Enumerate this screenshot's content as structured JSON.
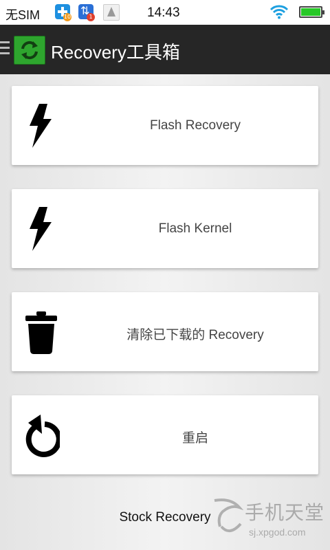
{
  "statusbar": {
    "carrier": "无SIM",
    "time": "14:43",
    "notifications": [
      {
        "name": "plus-app-icon",
        "badge": "10"
      },
      {
        "name": "sync-app-icon",
        "badge": "1"
      },
      {
        "name": "ship-icon"
      }
    ],
    "wifi_icon": "wifi-icon",
    "battery_icon": "battery-full-icon",
    "battery_color": "#28c828"
  },
  "actionbar": {
    "title": "Recovery工具箱",
    "app_icon": "refresh-arrows-icon",
    "background": "#262626"
  },
  "cards": [
    {
      "label": "Flash Recovery",
      "icon": "lightning-icon"
    },
    {
      "label": "Flash Kernel",
      "icon": "lightning-icon"
    },
    {
      "label": "清除已下载的 Recovery",
      "icon": "trash-icon"
    },
    {
      "label": "重启",
      "icon": "restart-icon"
    }
  ],
  "footer": {
    "stock_label": "Stock Recovery"
  },
  "watermark": {
    "title": "手机天堂",
    "url": "sj.xpgod.com"
  }
}
